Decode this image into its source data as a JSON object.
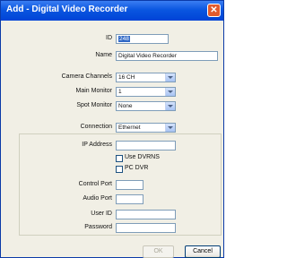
{
  "window": {
    "title": "Add - Digital Video Recorder",
    "close_glyph": "✕"
  },
  "form": {
    "id_label": "ID",
    "id_value": "248",
    "name_label": "Name",
    "name_value": "Digital Video Recorder",
    "camera_channels_label": "Camera Channels",
    "camera_channels_value": "16 CH",
    "main_monitor_label": "Main Monitor",
    "main_monitor_value": "1",
    "spot_monitor_label": "Spot Monitor",
    "spot_monitor_value": "None",
    "connection_label": "Connection",
    "connection_value": "Ethernet",
    "ip_address_label": "IP Address",
    "ip_address_value": "",
    "use_dvrns_label": "Use DVRNS",
    "use_dvrns_checked": false,
    "pc_dvr_label": "PC DVR",
    "pc_dvr_checked": false,
    "control_port_label": "Control Port",
    "control_port_value": "",
    "audio_port_label": "Audio Port",
    "audio_port_value": "",
    "user_id_label": "User ID",
    "user_id_value": "",
    "password_label": "Password",
    "password_value": ""
  },
  "buttons": {
    "ok_label": "OK",
    "ok_enabled": false,
    "cancel_label": "Cancel"
  },
  "colors": {
    "title_bar": "#0a56e0",
    "field_border": "#7f9db9",
    "selection": "#3169c6"
  }
}
